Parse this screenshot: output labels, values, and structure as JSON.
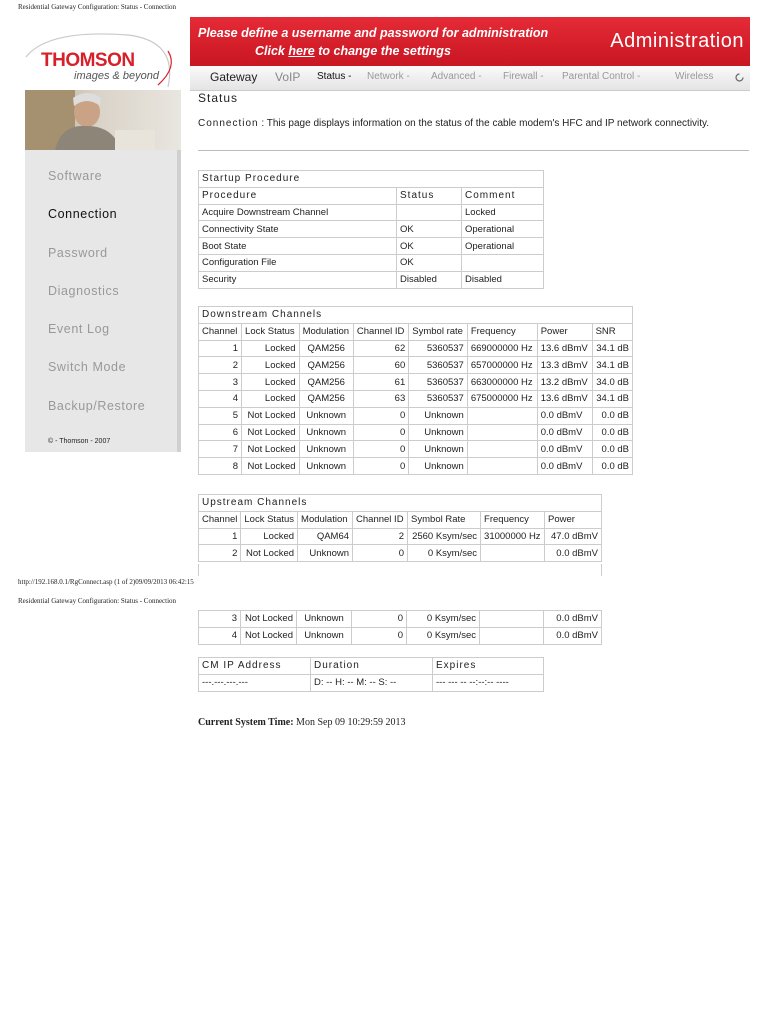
{
  "page_header": "Residential Gateway Configuration: Status - Connection",
  "logo": {
    "title": "THOMSON",
    "subtitle": "images & beyond"
  },
  "banner": {
    "line1": "Please define a username and password for administration",
    "line2_pre": "Click ",
    "line2_link": "here",
    "line2_post": " to change the settings",
    "admin": "Administration"
  },
  "nav": {
    "gateway": "Gateway",
    "voip": "VoIP",
    "status": "Status -",
    "network": "Network -",
    "advanced": "Advanced -",
    "firewall": "Firewall -",
    "parental": "Parental Control -",
    "wireless": "Wireless"
  },
  "sidebar": {
    "items": [
      {
        "label": "Software"
      },
      {
        "label": "Connection"
      },
      {
        "label": "Password"
      },
      {
        "label": "Diagnostics"
      },
      {
        "label": "Event Log"
      },
      {
        "label": "Switch Mode"
      },
      {
        "label": "Backup/Restore"
      }
    ],
    "active": "Connection",
    "copyright": "© - Thomson - 2007"
  },
  "status": {
    "title": "Status",
    "desc_label": "Connection",
    "desc_sep": ":",
    "desc_text": "This page displays information on the status of the cable modem's HFC and IP network connectivity."
  },
  "startup": {
    "caption": "Startup Procedure",
    "headers": [
      "Procedure",
      "Status",
      "Comment"
    ],
    "rows": [
      [
        "Acquire Downstream Channel",
        "",
        "Locked"
      ],
      [
        "Connectivity State",
        "OK",
        "Operational"
      ],
      [
        "Boot State",
        "OK",
        "Operational"
      ],
      [
        "Configuration File",
        "OK",
        ""
      ],
      [
        "Security",
        "Disabled",
        "Disabled"
      ]
    ]
  },
  "downstream": {
    "caption": "Downstream Channels",
    "headers": [
      "Channel",
      "Lock Status",
      "Modulation",
      "Channel ID",
      "Symbol rate",
      "Frequency",
      "Power",
      "SNR"
    ],
    "rows": [
      [
        "1",
        "Locked",
        "QAM256",
        "62",
        "5360537",
        "669000000 Hz",
        "13.6 dBmV",
        "34.1 dB"
      ],
      [
        "2",
        "Locked",
        "QAM256",
        "60",
        "5360537",
        "657000000 Hz",
        "13.3 dBmV",
        "34.1 dB"
      ],
      [
        "3",
        "Locked",
        "QAM256",
        "61",
        "5360537",
        "663000000 Hz",
        "13.2 dBmV",
        "34.0 dB"
      ],
      [
        "4",
        "Locked",
        "QAM256",
        "63",
        "5360537",
        "675000000 Hz",
        "13.6 dBmV",
        "34.1 dB"
      ],
      [
        "5",
        "Not Locked",
        "Unknown",
        "0",
        "Unknown",
        "",
        "0.0 dBmV",
        "0.0 dB"
      ],
      [
        "6",
        "Not Locked",
        "Unknown",
        "0",
        "Unknown",
        "",
        "0.0 dBmV",
        "0.0 dB"
      ],
      [
        "7",
        "Not Locked",
        "Unknown",
        "0",
        "Unknown",
        "",
        "0.0 dBmV",
        "0.0 dB"
      ],
      [
        "8",
        "Not Locked",
        "Unknown",
        "0",
        "Unknown",
        "",
        "0.0 dBmV",
        "0.0 dB"
      ]
    ]
  },
  "upstream": {
    "caption": "Upstream Channels",
    "headers": [
      "Channel",
      "Lock Status",
      "Modulation",
      "Channel ID",
      "Symbol Rate",
      "Frequency",
      "Power"
    ],
    "rows": [
      [
        "1",
        "Locked",
        "QAM64",
        "2",
        "2560 Ksym/sec",
        "31000000 Hz",
        "47.0 dBmV"
      ],
      [
        "2",
        "Not Locked",
        "Unknown",
        "0",
        "0 Ksym/sec",
        "",
        "0.0 dBmV"
      ]
    ],
    "rows_page2": [
      [
        "3",
        "Not Locked",
        "Unknown",
        "0",
        "0 Ksym/sec",
        "",
        "0.0 dBmV"
      ],
      [
        "4",
        "Not Locked",
        "Unknown",
        "0",
        "0 Ksym/sec",
        "",
        "0.0 dBmV"
      ]
    ]
  },
  "print_footer": {
    "url": "http://192.168.0.1/RgConnect.asp (1 of 2)09/09/2013 06:42:15",
    "header2": "Residential Gateway Configuration: Status - Connection"
  },
  "cmip": {
    "headers": [
      "CM IP Address",
      "Duration",
      "Expires"
    ],
    "values": [
      "---.---.---.---",
      "D: -- H: -- M: -- S: --",
      "--- --- -- --:--:-- ----"
    ]
  },
  "system_time": {
    "label": "Current System Time:",
    "value": " Mon Sep 09 10:29:59 2013"
  }
}
